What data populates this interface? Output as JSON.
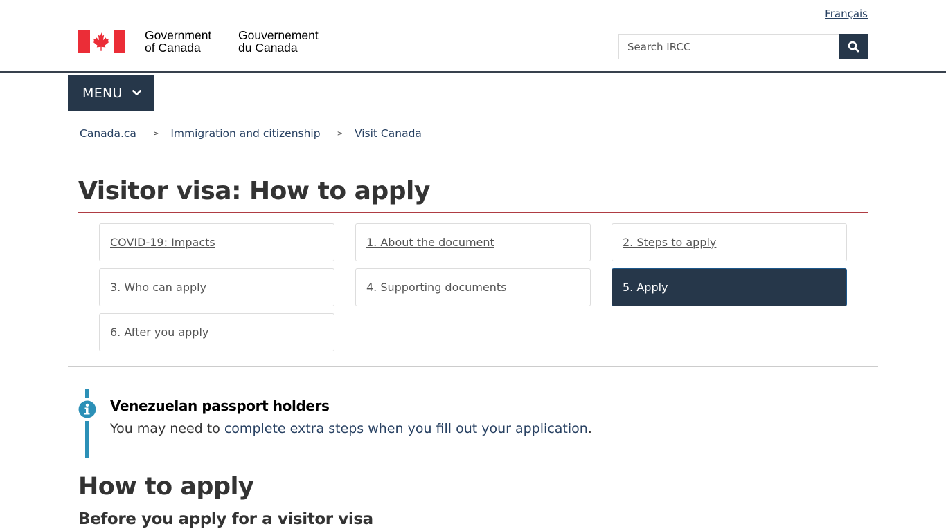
{
  "header": {
    "signature_en_line1": "Government",
    "signature_en_line2": "of Canada",
    "signature_fr_line1": "Gouvernement",
    "signature_fr_line2": "du Canada",
    "language_link": "Français",
    "search_placeholder": "Search IRCC",
    "search_icon": "search-icon",
    "flag_icon": "canada-flag-icon",
    "colors": {
      "flag_red": "#eb2d37",
      "nav_dark": "#26374a"
    }
  },
  "menu": {
    "label": "MENU",
    "icon": "chevron-down-icon"
  },
  "breadcrumb": [
    {
      "label": "Canada.ca"
    },
    {
      "label": "Immigration and citizenship"
    },
    {
      "label": "Visit Canada"
    }
  ],
  "breadcrumb_separator": ">",
  "page": {
    "title": "Visitor visa: How to apply",
    "title_rule_color": "#af3c43"
  },
  "steps": [
    {
      "label": "COVID-19: Impacts",
      "active": false
    },
    {
      "label": "1. About the document",
      "active": false
    },
    {
      "label": "2. Steps to apply",
      "active": false
    },
    {
      "label": "3. Who can apply",
      "active": false
    },
    {
      "label": "4. Supporting documents",
      "active": false
    },
    {
      "label": "5. Apply",
      "active": true
    },
    {
      "label": "6. After you apply",
      "active": false
    }
  ],
  "alert": {
    "type": "info",
    "icon": "info-icon",
    "title": "Venezuelan passport holders",
    "body_prefix": "You may need to ",
    "body_link": "complete extra steps when you fill out your application",
    "body_suffix": ".",
    "color": "#2c90b7"
  },
  "content": {
    "h2": "How to apply",
    "h3": "Before you apply for a visitor visa"
  }
}
